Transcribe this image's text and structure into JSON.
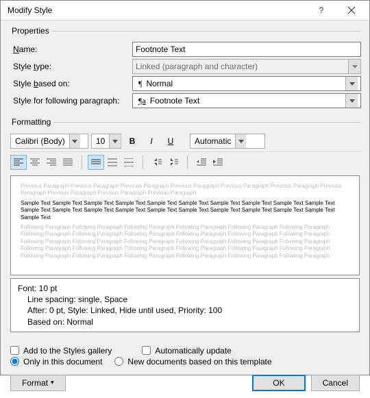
{
  "window": {
    "title": "Modify Style"
  },
  "sections": {
    "properties": "Properties",
    "formatting": "Formatting"
  },
  "properties": {
    "name_label": "Name:",
    "name_value": "Footnote Text",
    "type_label": "Style type:",
    "type_value": "Linked (paragraph and character)",
    "based_label": "Style based on:",
    "based_value": "Normal",
    "following_label": "Style for following paragraph:",
    "following_value": "Footnote Text"
  },
  "formatting": {
    "font_name": "Calibri (Body)",
    "font_size": "10",
    "color_value": "Automatic"
  },
  "preview": {
    "prev": "Previous Paragraph Previous Paragraph Previous Paragraph Previous Paragraph Previous Paragraph Previous Paragraph Previous Paragraph Previous Paragraph Previous Paragraph Previous Paragraph",
    "sample": "Sample Text Sample Text Sample Text Sample Text Sample Text Sample Text Sample Text Sample Text Sample Text Sample Text Sample Text Sample Text Sample Text Sample Text Sample Text Sample Text Sample Text Sample Text Sample Text Sample Text Sample Text",
    "follow": "Following Paragraph Following Paragraph Following Paragraph Following Paragraph Following Paragraph Following Paragraph Following Paragraph Following Paragraph Following Paragraph Following Paragraph Following Paragraph Following Paragraph Following Paragraph Following Paragraph Following Paragraph Following Paragraph Following Paragraph Following Paragraph Following Paragraph Following Paragraph Following Paragraph Following Paragraph Following Paragraph Following Paragraph Following Paragraph Following Paragraph Following Paragraph Following Paragraph Following Paragraph Following Paragraph"
  },
  "description": {
    "l1": "Font: 10 pt",
    "l2": "Line spacing:  single, Space",
    "l3": "After:  0 pt, Style: Linked, Hide until used, Priority: 100",
    "l4": "Based on: Normal"
  },
  "checks": {
    "add_gallery": "Add to the Styles gallery",
    "auto_update": "Automatically update",
    "only_doc": "Only in this document",
    "new_template": "New documents based on this template"
  },
  "buttons": {
    "format": "Format",
    "ok": "OK",
    "cancel": "Cancel"
  }
}
